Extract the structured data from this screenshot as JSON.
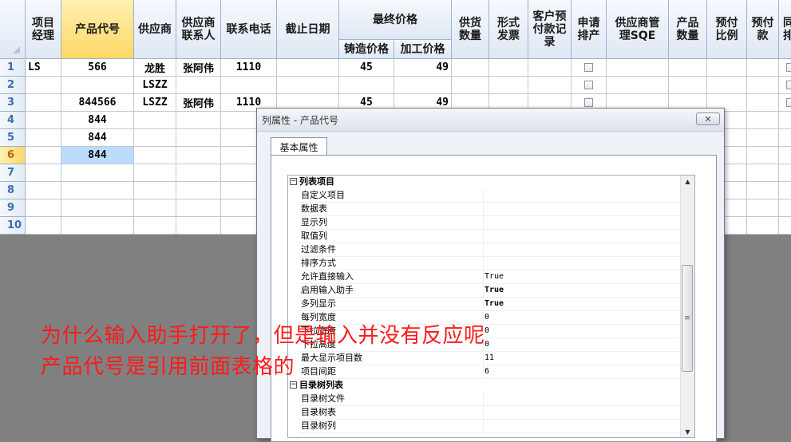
{
  "sheet": {
    "header_top": {
      "manager": "项目\n经理",
      "product_code": "产品代号",
      "supplier": "供应商",
      "supplier_contact": "供应商\n联系人",
      "phone": "联系电话",
      "deadline": "截止日期",
      "final_price": "最终价格",
      "supply_qty": "供货\n数量",
      "invoice": "形式\n发票",
      "prepay_record": "客户预\n付款记\n录",
      "apply_schedule": "申请\n排产",
      "supplier_sqe": "供应商管\n理SQE",
      "product_qty": "产品\n数量",
      "prepay_ratio": "预付\n比例",
      "prepay": "预付\n款",
      "same": "同\n排"
    },
    "header_sub": {
      "cast_price": "铸造价格",
      "process_price": "加工价格"
    },
    "rows": [
      {
        "no": "1",
        "manager": "LS",
        "code": "566",
        "supplier": "龙胜",
        "contact": "张阿伟",
        "phone": "1110",
        "cast": "45",
        "process": "49"
      },
      {
        "no": "2",
        "manager": "",
        "code": "",
        "supplier": "LSZZ",
        "contact": "",
        "phone": "",
        "cast": "",
        "process": ""
      },
      {
        "no": "3",
        "manager": "",
        "code": "844566",
        "supplier": "LSZZ",
        "contact": "张阿伟",
        "phone": "1110",
        "cast": "45",
        "process": "49"
      },
      {
        "no": "4",
        "manager": "",
        "code": "844",
        "supplier": "",
        "contact": "",
        "phone": "",
        "cast": "",
        "process": ""
      },
      {
        "no": "5",
        "manager": "",
        "code": "844",
        "supplier": "",
        "contact": "",
        "phone": "",
        "cast": "",
        "process": ""
      },
      {
        "no": "6",
        "manager": "",
        "code": "844",
        "supplier": "",
        "contact": "",
        "phone": "",
        "cast": "",
        "process": ""
      },
      {
        "no": "7",
        "manager": "",
        "code": "",
        "supplier": "",
        "contact": "",
        "phone": "",
        "cast": "",
        "process": ""
      },
      {
        "no": "8",
        "manager": "",
        "code": "",
        "supplier": "",
        "contact": "",
        "phone": "",
        "cast": "",
        "process": ""
      },
      {
        "no": "9",
        "manager": "",
        "code": "",
        "supplier": "",
        "contact": "",
        "phone": "",
        "cast": "",
        "process": ""
      },
      {
        "no": "10",
        "manager": "",
        "code": "",
        "supplier": "",
        "contact": "",
        "phone": "",
        "cast": "",
        "process": ""
      }
    ],
    "active_row": "6",
    "active_column": "产品代号"
  },
  "dialog": {
    "title": "列属性 - 产品代号",
    "close_icon": "close-x-icon",
    "tab_label": "基本属性",
    "properties": [
      {
        "type": "category",
        "name": "列表项目",
        "toggle": "⊟"
      },
      {
        "type": "prop",
        "name": "自定义项目",
        "value": ""
      },
      {
        "type": "prop",
        "name": "数据表",
        "value": ""
      },
      {
        "type": "prop",
        "name": "显示列",
        "value": ""
      },
      {
        "type": "prop",
        "name": "取值列",
        "value": ""
      },
      {
        "type": "prop",
        "name": "过滤条件",
        "value": ""
      },
      {
        "type": "prop",
        "name": "排序方式",
        "value": ""
      },
      {
        "type": "prop",
        "name": "允许直接输入",
        "value": "True",
        "bold": false
      },
      {
        "type": "prop",
        "name": "启用输入助手",
        "value": "True",
        "bold": true
      },
      {
        "type": "prop",
        "name": "多列显示",
        "value": "True",
        "bold": true
      },
      {
        "type": "prop",
        "name": "每列宽度",
        "value": "0"
      },
      {
        "type": "prop",
        "name": "下拉宽度",
        "value": "0"
      },
      {
        "type": "prop",
        "name": "下拉高度",
        "value": "0"
      },
      {
        "type": "prop",
        "name": "最大显示项目数",
        "value": "11"
      },
      {
        "type": "prop",
        "name": "项目间距",
        "value": "6"
      },
      {
        "type": "category",
        "name": "目录树列表",
        "toggle": "⊟"
      },
      {
        "type": "prop",
        "name": "目录树文件",
        "value": ""
      },
      {
        "type": "prop",
        "name": "目录树表",
        "value": ""
      },
      {
        "type": "prop",
        "name": "目录树列",
        "value": ""
      }
    ]
  },
  "annotation": {
    "line1": "为什么输入助手打开了，但是输入并没有反应呢",
    "line2": "产品代号是引用前面表格的",
    "color": "#ff1a1a"
  },
  "colors": {
    "header_bg": "#dfe8f4",
    "selected_header": "#ffd766",
    "active_cell": "#bcdcff",
    "row_number": "#3a6fb0"
  }
}
